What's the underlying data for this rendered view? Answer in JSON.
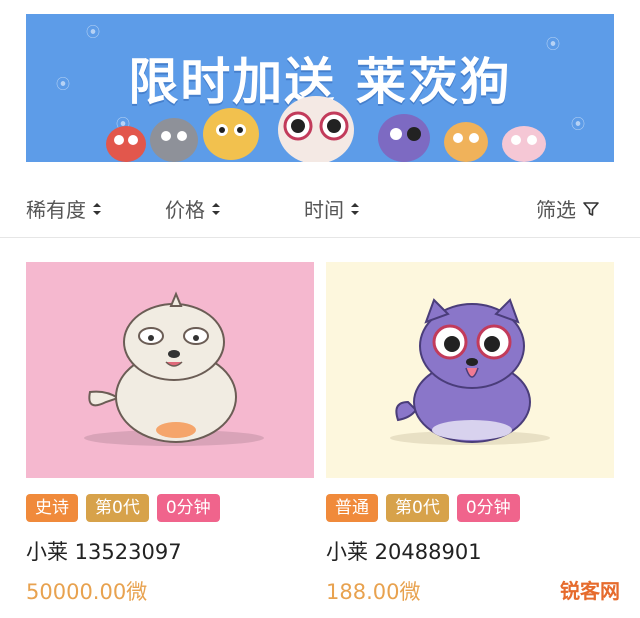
{
  "banner": {
    "title": "限时加送 莱茨狗"
  },
  "filters": [
    {
      "label": "稀有度",
      "icon": "sort-icon"
    },
    {
      "label": "价格",
      "icon": "sort-icon"
    },
    {
      "label": "时间",
      "icon": "sort-icon"
    }
  ],
  "filter_button": {
    "label": "筛选",
    "icon": "funnel-icon"
  },
  "cards": [
    {
      "bg": "#f5b8cf",
      "tags": [
        {
          "label": "史诗",
          "color": "#f08a3b"
        },
        {
          "label": "第0代",
          "color": "#d7a24a"
        },
        {
          "label": "0分钟",
          "color": "#f0648c"
        }
      ],
      "name": "小莱 13523097",
      "price": "50000.00微"
    },
    {
      "bg": "#fdf7dd",
      "tags": [
        {
          "label": "普通",
          "color": "#f08a3b"
        },
        {
          "label": "第0代",
          "color": "#d7a24a"
        },
        {
          "label": "0分钟",
          "color": "#f0648c"
        }
      ],
      "name": "小莱 20488901",
      "price": "188.00微"
    }
  ],
  "watermark": "锐客网"
}
